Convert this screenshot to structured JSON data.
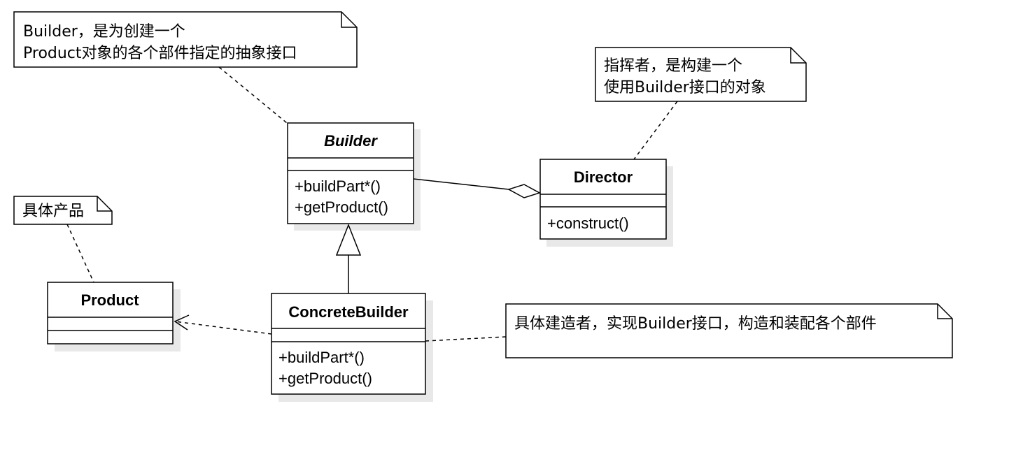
{
  "notes": {
    "builder_note": [
      "Builder，是为创建一个",
      "Product对象的各个部件指定的抽象接口"
    ],
    "director_note": [
      "指挥者，是构建一个",
      "使用Builder接口的对象"
    ],
    "product_note": [
      "具体产品"
    ],
    "concrete_note": [
      "具体建造者，实现Builder接口，构造和装配各个部件"
    ]
  },
  "classes": {
    "builder": {
      "name": "Builder",
      "attributes": [],
      "operations": [
        "+buildPart*()",
        "+getProduct()"
      ]
    },
    "director": {
      "name": "Director",
      "attributes": [],
      "operations": [
        "+construct()"
      ]
    },
    "product": {
      "name": "Product",
      "attributes": [],
      "operations": []
    },
    "concrete_builder": {
      "name": "ConcreteBuilder",
      "attributes": [],
      "operations": [
        "+buildPart*()",
        "+getProduct()"
      ]
    }
  },
  "relations": {
    "aggregation": {
      "from": "Director",
      "to": "Builder"
    },
    "generalization": {
      "from": "ConcreteBuilder",
      "to": "Builder"
    },
    "dependency": {
      "from": "ConcreteBuilder",
      "to": "Product"
    }
  }
}
